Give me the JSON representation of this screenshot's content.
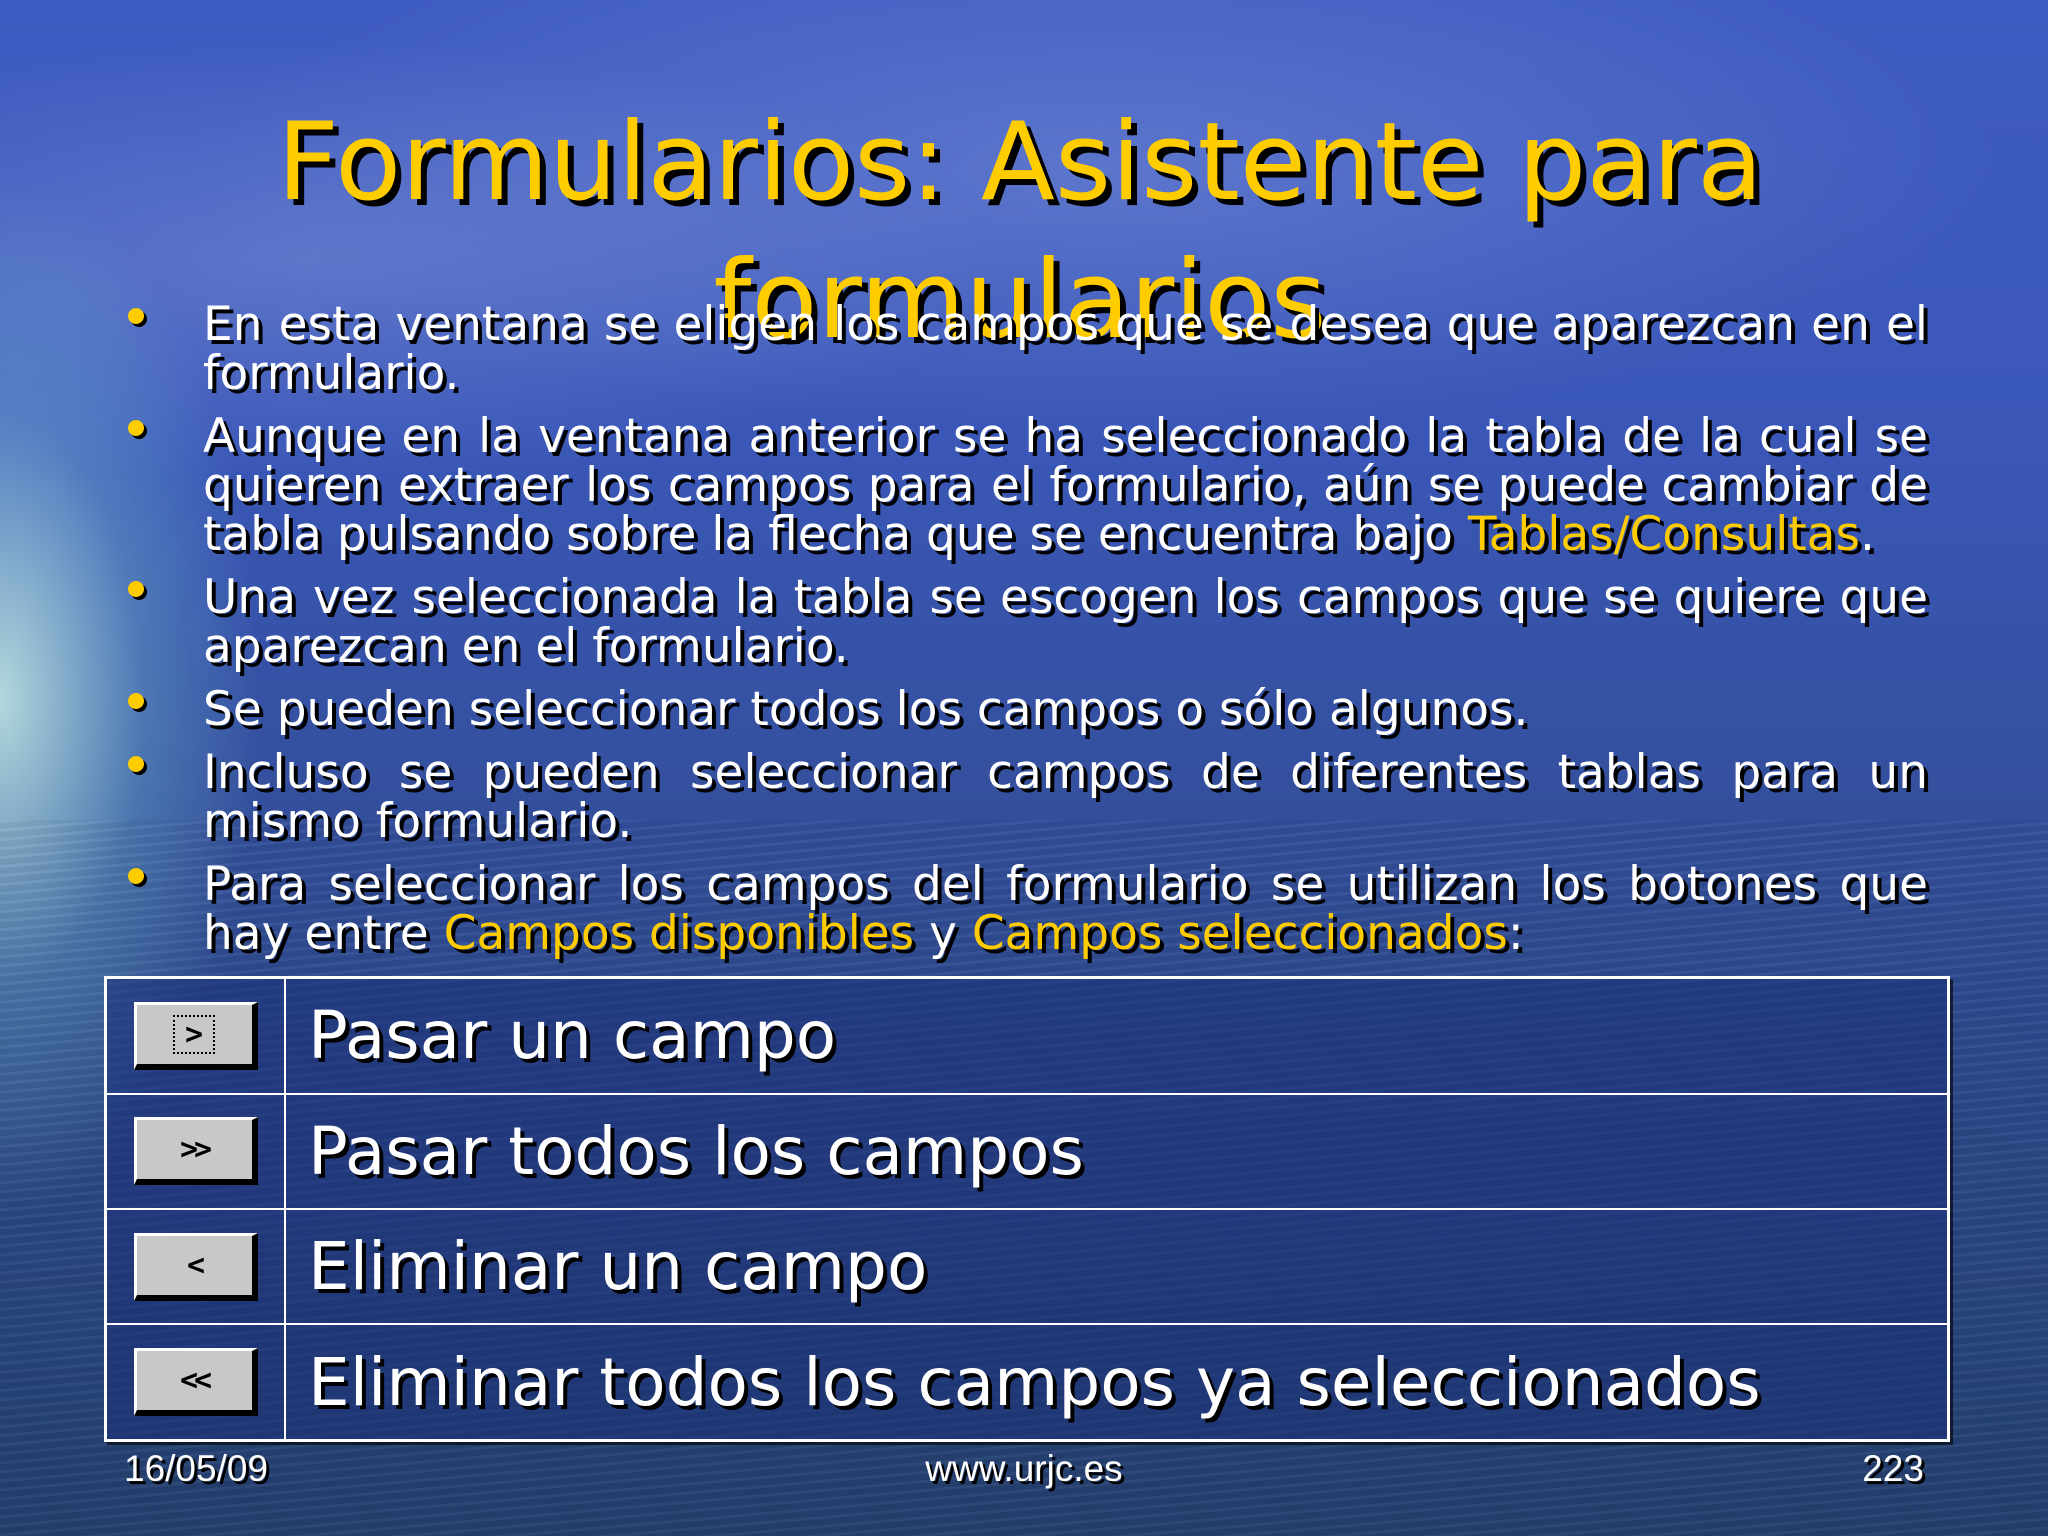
{
  "title": {
    "line1": "Formularios: Asistente para",
    "line2": "formularios"
  },
  "bullets": [
    {
      "parts": [
        "En esta ventana se eligen los campos que se desea que aparezcan en el formulario."
      ]
    },
    {
      "parts": [
        "Aunque en la ventana anterior se ha seleccionado la tabla de la cual se quieren extraer los campos para el formulario, aún se puede cambiar de tabla pulsando sobre la flecha que se encuentra bajo ",
        "Tablas/Consultas",
        "."
      ]
    },
    {
      "parts": [
        "Una vez seleccionada la tabla se escogen los campos que se quiere que aparezcan en el formulario."
      ]
    },
    {
      "parts": [
        "Se pueden seleccionar todos los campos o sólo algunos."
      ]
    },
    {
      "parts": [
        "Incluso se pueden seleccionar campos de diferentes tablas para un mismo formulario."
      ]
    },
    {
      "parts": [
        "Para seleccionar los campos del formulario se utilizan los botones que hay entre ",
        "Campos disponibles",
        " y ",
        "Campos seleccionados",
        ":"
      ]
    }
  ],
  "buttons_table": [
    {
      "icon": "move-one-icon",
      "glyph": ">",
      "label": "Pasar un campo"
    },
    {
      "icon": "move-all-icon",
      "glyph": ">>",
      "label": "Pasar todos los campos"
    },
    {
      "icon": "remove-one-icon",
      "glyph": "<",
      "label": "Eliminar un campo"
    },
    {
      "icon": "remove-all-icon",
      "glyph": "<<",
      "label": "Eliminar todos los campos ya seleccionados"
    }
  ],
  "footer": {
    "date": "16/05/09",
    "url": "www.urjc.es",
    "page": "223"
  },
  "colors": {
    "title": "#ffcc00",
    "highlight": "#ffcc00",
    "text": "#ffffff"
  }
}
